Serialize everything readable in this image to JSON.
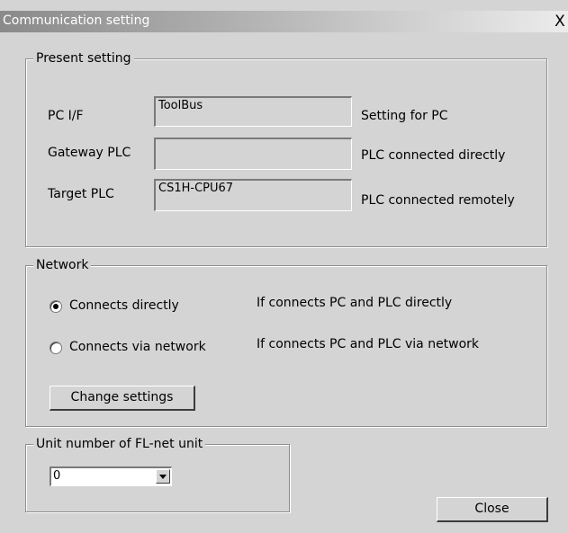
{
  "window": {
    "title": "Communication setting",
    "close_glyph": "X"
  },
  "present_setting": {
    "legend": "Present setting",
    "rows": [
      {
        "label": "PC I/F",
        "value": "ToolBus",
        "note": "Setting for PC"
      },
      {
        "label": "Gateway PLC",
        "value": "",
        "note": "PLC connected directly"
      },
      {
        "label": "Target PLC",
        "value": "CS1H-CPU67",
        "note": "PLC connected remotely"
      }
    ]
  },
  "network": {
    "legend": "Network",
    "options": [
      {
        "label": "Connects directly",
        "description": "If connects PC and PLC directly",
        "selected": true
      },
      {
        "label": "Connects via network",
        "description": "If connects PC and PLC via network",
        "selected": false
      }
    ],
    "change_button": "Change settings"
  },
  "fl_net": {
    "legend": "Unit number of FL-net unit",
    "selected_value": "0"
  },
  "close_button": "Close",
  "icons": {
    "close": "close-icon",
    "dropdown": "chevron-down-icon"
  },
  "colors": {
    "face": "#d4d4d4",
    "title_gradient_start": "#8a8a8a",
    "title_gradient_end": "#ececec"
  }
}
